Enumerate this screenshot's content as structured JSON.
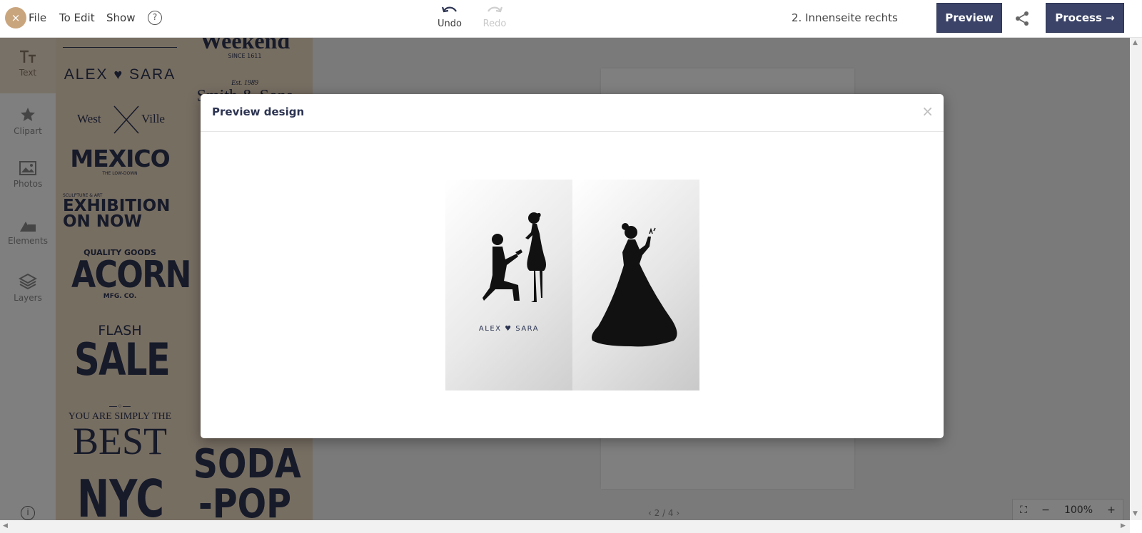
{
  "topbar": {
    "close_symbol": "×",
    "menu": [
      "File",
      "To Edit",
      "Show"
    ],
    "help_symbol": "?",
    "undo_label": "Undo",
    "redo_label": "Redo",
    "page_label": "2. Innenseite rechts",
    "preview_label": "Preview",
    "process_label": "Process →",
    "accent_color": "#3b4468",
    "brand_color": "#c9a57e"
  },
  "sidebar": {
    "items": [
      {
        "label": "Text",
        "icon": "text-icon"
      },
      {
        "label": "Clipart",
        "icon": "star-icon"
      },
      {
        "label": "Photos",
        "icon": "photo-icon"
      },
      {
        "label": "Elements",
        "icon": "shapes-icon"
      },
      {
        "label": "Layers",
        "icon": "layers-icon"
      }
    ],
    "info_symbol": "i"
  },
  "templates": {
    "weekend_since": "SINCE 1611",
    "est": "Est. 1989",
    "smith": "Smith & Sons",
    "alex": "ALEX",
    "sara": "SARA",
    "west": "West",
    "ville": "Ville",
    "mexico": "MEXICO",
    "mexico_sub": "THE LOW-DOWN",
    "sculpture": "SCULPTURE & ART",
    "exhibition": "EXHIBITION",
    "on_now": "ON NOW",
    "quality": "QUALITY GOODS",
    "acorn": "ACORN",
    "mfg": "MFG. CO.",
    "flash": "FLASH",
    "sale": "SALE",
    "simply": "YOU ARE SIMPLY THE",
    "best": "BEST",
    "nyc": "NYC",
    "soda": "SODA",
    "pop": "-POP"
  },
  "canvas": {
    "zoom_out": "−",
    "zoom_level": "100%",
    "zoom_in": "+",
    "pager": "‹   2 / 4   ›"
  },
  "modal": {
    "title": "Preview design",
    "close_symbol": "×",
    "names_text": "ALEX ♥ SARA"
  }
}
